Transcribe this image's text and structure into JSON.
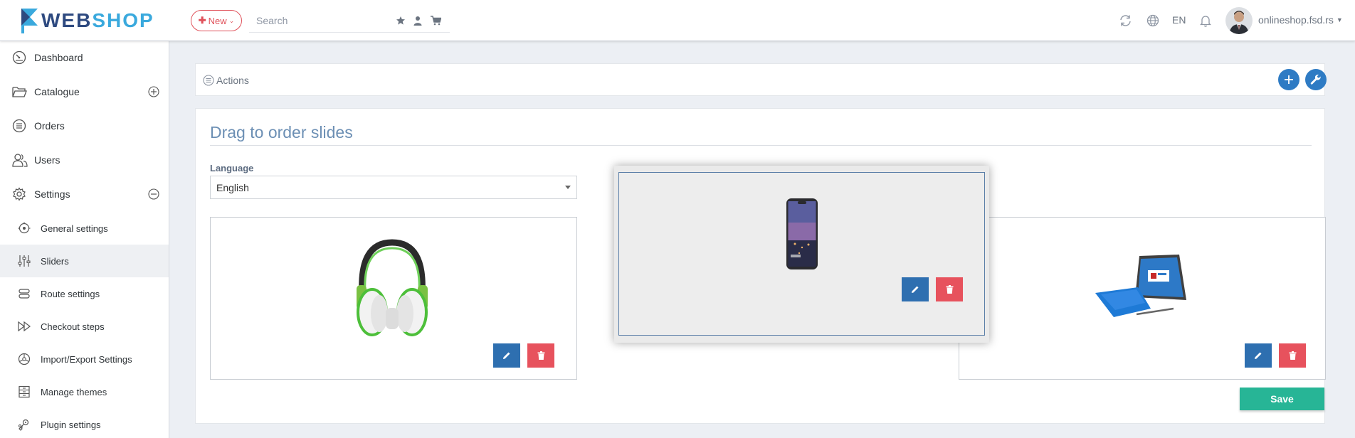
{
  "header": {
    "logo_web": "WEB",
    "logo_shop": "SHOP",
    "new_button": "New",
    "search": {
      "placeholder": "Search",
      "value": ""
    },
    "language": "EN",
    "username": "onlineshop.fsd.rs"
  },
  "sidebar": {
    "items": [
      {
        "label": "Dashboard",
        "icon": "dashboard-icon"
      },
      {
        "label": "Catalogue",
        "icon": "folder-icon",
        "toggle": "expand"
      },
      {
        "label": "Orders",
        "icon": "list-icon"
      },
      {
        "label": "Users",
        "icon": "users-icon"
      },
      {
        "label": "Settings",
        "icon": "gear-icon",
        "toggle": "collapse"
      }
    ],
    "subitems": [
      {
        "label": "General settings",
        "icon": "settings-circle-icon"
      },
      {
        "label": "Sliders",
        "icon": "sliders-icon",
        "active": true
      },
      {
        "label": "Route settings",
        "icon": "route-icon"
      },
      {
        "label": "Checkout steps",
        "icon": "fast-forward-icon"
      },
      {
        "label": "Import/Export Settings",
        "icon": "import-export-icon"
      },
      {
        "label": "Manage themes",
        "icon": "themes-icon"
      },
      {
        "label": "Plugin settings",
        "icon": "plugin-icon"
      }
    ]
  },
  "actions": {
    "label": "Actions"
  },
  "main": {
    "title": "Drag to order slides",
    "language_label": "Language",
    "language_value": "English",
    "save_label": "Save",
    "slides": [
      {
        "image": "headphones"
      },
      {
        "image": "smartphone",
        "dragging": true
      },
      {
        "image": "tablet-laptop"
      }
    ]
  },
  "colors": {
    "primary_blue": "#2e7bc4",
    "edit_blue": "#2e6fb0",
    "delete_red": "#e7525d",
    "save_green": "#27b596",
    "new_red": "#e0525b",
    "logo_dark": "#2e4a80",
    "logo_light": "#3aa9dd"
  }
}
